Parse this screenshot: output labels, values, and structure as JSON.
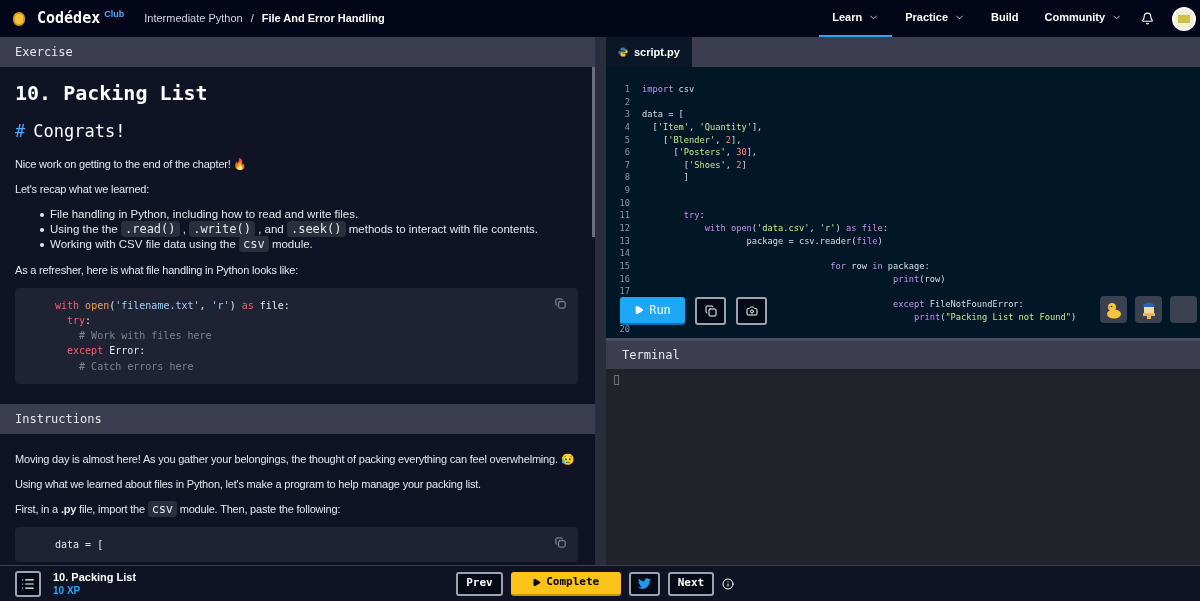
{
  "header": {
    "logo": "Codédex",
    "logo_badge": "Club",
    "separator": "/",
    "breadcrumb": [
      {
        "label": "Intermediate Python",
        "current": false
      },
      {
        "label": "File And Error Handling",
        "current": true
      }
    ],
    "nav": [
      {
        "label": "Learn",
        "dropdown": true,
        "selected": true
      },
      {
        "label": "Practice",
        "dropdown": true,
        "selected": false
      },
      {
        "label": "Build",
        "dropdown": false,
        "selected": false
      },
      {
        "label": "Community",
        "dropdown": true,
        "selected": false
      }
    ]
  },
  "exercise": {
    "header": "Exercise",
    "title": "10. Packing List",
    "blocks": [
      {
        "kind": "heading",
        "mark": "#",
        "text": "Congrats!"
      },
      {
        "kind": "paragraph",
        "parts": [
          {
            "kind": "text",
            "text": "Nice work on getting to the end of the chapter! 🔥"
          }
        ]
      },
      {
        "kind": "paragraph",
        "parts": [
          {
            "kind": "text",
            "text": "Let's recap what we learned:"
          }
        ]
      },
      {
        "kind": "list",
        "items": [
          [
            {
              "kind": "text",
              "text": "File handling in Python, including how to read and write files."
            }
          ],
          [
            {
              "kind": "text",
              "text": "Using the the"
            },
            {
              "kind": "code",
              "text": ".read()"
            },
            {
              "kind": "text",
              "text": ","
            },
            {
              "kind": "code",
              "text": ".write()"
            },
            {
              "kind": "text",
              "text": ", and"
            },
            {
              "kind": "code",
              "text": ".seek()"
            },
            {
              "kind": "text",
              "text": "methods to interact with file contents."
            }
          ],
          [
            {
              "kind": "text",
              "text": "Working with CSV file data using the"
            },
            {
              "kind": "code",
              "text": "csv"
            },
            {
              "kind": "text",
              "text": "module."
            }
          ]
        ]
      },
      {
        "kind": "paragraph",
        "parts": [
          {
            "kind": "text",
            "text": "As a refresher, here is what file handling in Python looks like:"
          }
        ]
      },
      {
        "kind": "code",
        "lines": [
          [
            {
              "kind": "keyword",
              "text": "with "
            },
            {
              "kind": "func",
              "text": "open"
            },
            {
              "kind": "plain",
              "text": "("
            },
            {
              "kind": "string",
              "text": "'filename.txt'"
            },
            {
              "kind": "plain",
              "text": ", "
            },
            {
              "kind": "string",
              "text": "'r'"
            },
            {
              "kind": "plain",
              "text": ") "
            },
            {
              "kind": "keyword",
              "text": "as "
            },
            {
              "kind": "plain",
              "text": "file:"
            }
          ],
          [
            {
              "kind": "keyword",
              "text": "  try"
            },
            {
              "kind": "plain",
              "text": ":"
            }
          ],
          [
            {
              "kind": "comment",
              "text": "    # Work with files here"
            }
          ],
          [
            {
              "kind": "keyword",
              "text": "  except "
            },
            {
              "kind": "plain",
              "text": "Error:"
            }
          ],
          [
            {
              "kind": "comment",
              "text": "    # Catch errors here"
            }
          ]
        ]
      }
    ]
  },
  "instructions": {
    "header": "Instructions",
    "blocks": [
      {
        "kind": "paragraph",
        "parts": [
          {
            "kind": "text",
            "text": "Moving day is almost here! As you gather your belongings, the thought of packing everything can feel overwhelming. 😥"
          }
        ]
      },
      {
        "kind": "paragraph",
        "parts": [
          {
            "kind": "text",
            "text": "Using what we learned about files in Python, let's make a program to help manage your packing list."
          }
        ]
      },
      {
        "kind": "paragraph",
        "parts": [
          {
            "kind": "text",
            "text": "First, in a **.py** file, import the"
          },
          {
            "kind": "code",
            "text": "csv"
          },
          {
            "kind": "text",
            "text": "module. Then, paste the following:"
          }
        ]
      },
      {
        "kind": "code",
        "lines": [
          [
            {
              "kind": "plain",
              "text": "data = ["
            }
          ]
        ]
      }
    ]
  },
  "editor": {
    "tab": "script.py",
    "lines": [
      {
        "number": "1",
        "tokens": [
          {
            "kind": "keyword",
            "text": "import"
          },
          {
            "kind": "plain",
            "text": " csv"
          }
        ]
      },
      {
        "number": "2"
      },
      {
        "number": "3",
        "tokens": [
          {
            "kind": "plain",
            "text": "data = ["
          }
        ]
      },
      {
        "number": "4",
        "tokens": [
          {
            "kind": "plain",
            "text": "  ["
          },
          {
            "kind": "string",
            "text": "'Item'"
          },
          {
            "kind": "plain",
            "text": ", "
          },
          {
            "kind": "string",
            "text": "'Quantity'"
          },
          {
            "kind": "plain",
            "text": "],"
          }
        ]
      },
      {
        "number": "5",
        "tokens": [
          {
            "kind": "plain",
            "text": "    ["
          },
          {
            "kind": "string",
            "text": "'Blender'"
          },
          {
            "kind": "plain",
            "text": ", "
          },
          {
            "kind": "number",
            "text": "2"
          },
          {
            "kind": "plain",
            "text": "],"
          }
        ]
      },
      {
        "number": "6",
        "tokens": [
          {
            "kind": "plain",
            "text": "      ["
          },
          {
            "kind": "string",
            "text": "'Posters'"
          },
          {
            "kind": "plain",
            "text": ", "
          },
          {
            "kind": "number",
            "text": "30"
          },
          {
            "kind": "plain",
            "text": "],"
          }
        ]
      },
      {
        "number": "7",
        "tokens": [
          {
            "kind": "plain",
            "text": "        ["
          },
          {
            "kind": "string",
            "text": "'Shoes'"
          },
          {
            "kind": "plain",
            "text": ", "
          },
          {
            "kind": "number",
            "text": "2"
          },
          {
            "kind": "plain",
            "text": "]"
          }
        ]
      },
      {
        "number": "8",
        "tokens": [
          {
            "kind": "plain",
            "text": "        ]"
          }
        ]
      },
      {
        "number": "9"
      },
      {
        "number": "10"
      },
      {
        "number": "11",
        "tokens": [
          {
            "kind": "keyword",
            "text": "        try"
          },
          {
            "kind": "plain",
            "text": ":"
          }
        ]
      },
      {
        "number": "12",
        "tokens": [
          {
            "kind": "keyword",
            "text": "            with "
          },
          {
            "kind": "func",
            "text": "open"
          },
          {
            "kind": "plain",
            "text": "("
          },
          {
            "kind": "string",
            "text": "'data.csv'"
          },
          {
            "kind": "plain",
            "text": ", "
          },
          {
            "kind": "string",
            "text": "'r'"
          },
          {
            "kind": "plain",
            "text": ") "
          },
          {
            "kind": "keyword",
            "text": "as "
          },
          {
            "kind": "func",
            "text": "file"
          },
          {
            "kind": "plain",
            "text": ":"
          }
        ]
      },
      {
        "number": "13",
        "tokens": [
          {
            "kind": "plain",
            "text": "                    package = csv.reader("
          },
          {
            "kind": "func",
            "text": "file"
          },
          {
            "kind": "plain",
            "text": ")"
          }
        ]
      },
      {
        "number": "14"
      },
      {
        "number": "15",
        "tokens": [
          {
            "kind": "keyword",
            "text": "                                    for"
          },
          {
            "kind": "plain",
            "text": " row "
          },
          {
            "kind": "keyword",
            "text": "in"
          },
          {
            "kind": "plain",
            "text": " package:"
          }
        ]
      },
      {
        "number": "16",
        "tokens": [
          {
            "kind": "func",
            "text": "                                                print"
          },
          {
            "kind": "plain",
            "text": "(row)"
          }
        ]
      },
      {
        "number": "17"
      },
      {
        "tokens": [
          {
            "kind": "keyword",
            "text": "                                                except"
          },
          {
            "kind": "plain",
            "text": " FileNotFoundError:"
          }
        ]
      },
      {
        "tokens": [
          {
            "kind": "func",
            "text": "                                                    print"
          },
          {
            "kind": "plain",
            "text": "("
          },
          {
            "kind": "string",
            "text": "\"Packing List not Found\""
          },
          {
            "kind": "plain",
            "text": ")"
          }
        ]
      },
      {
        "number": "20"
      }
    ],
    "run_label": "Run"
  },
  "terminal": {
    "header": "Terminal"
  },
  "footer": {
    "title": "10. Packing List",
    "xp": "10 XP",
    "prev": "Prev",
    "complete": "Complete",
    "next": "Next"
  }
}
